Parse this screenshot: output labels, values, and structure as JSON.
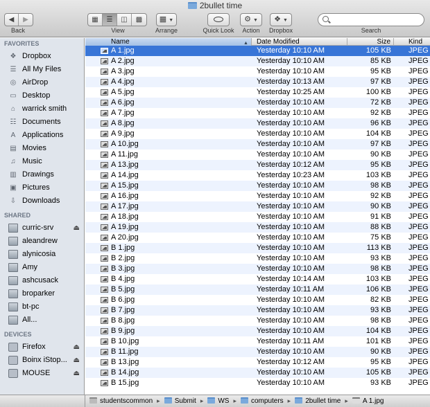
{
  "window": {
    "title": "2bullet time"
  },
  "toolbar": {
    "back_label": "Back",
    "view_label": "View",
    "arrange_label": "Arrange",
    "quicklook_label": "Quick Look",
    "action_label": "Action",
    "dropbox_label": "Dropbox",
    "search_label": "Search",
    "search_value": ""
  },
  "sidebar": {
    "favorites_heading": "FAVORITES",
    "favorites": [
      {
        "label": "Dropbox",
        "icon": "dropbox-icon"
      },
      {
        "label": "All My Files",
        "icon": "all-files-icon"
      },
      {
        "label": "AirDrop",
        "icon": "airdrop-icon"
      },
      {
        "label": "Desktop",
        "icon": "desktop-icon"
      },
      {
        "label": "warrick smith",
        "icon": "home-icon"
      },
      {
        "label": "Documents",
        "icon": "documents-icon"
      },
      {
        "label": "Applications",
        "icon": "applications-icon"
      },
      {
        "label": "Movies",
        "icon": "movies-icon"
      },
      {
        "label": "Music",
        "icon": "music-icon"
      },
      {
        "label": "Drawings",
        "icon": "folder-icon"
      },
      {
        "label": "Pictures",
        "icon": "pictures-icon"
      },
      {
        "label": "Downloads",
        "icon": "downloads-icon"
      }
    ],
    "shared_heading": "SHARED",
    "shared": [
      {
        "label": "curric-srv",
        "eject": true
      },
      {
        "label": "aleandrew",
        "eject": false
      },
      {
        "label": "alynicosia",
        "eject": false
      },
      {
        "label": "Amy",
        "eject": false
      },
      {
        "label": "ashcusack",
        "eject": false
      },
      {
        "label": "broparker",
        "eject": false
      },
      {
        "label": "bt-pc",
        "eject": false
      },
      {
        "label": "All...",
        "eject": false
      }
    ],
    "devices_heading": "DEVICES",
    "devices": [
      {
        "label": "Firefox",
        "eject": true
      },
      {
        "label": "Boinx iStop...",
        "eject": true
      },
      {
        "label": "MOUSE",
        "eject": true
      }
    ]
  },
  "columns": {
    "name": "Name",
    "date": "Date Modified",
    "size": "Size",
    "kind": "Kind"
  },
  "files": [
    {
      "name": "A 1.jpg",
      "date": "Yesterday 10:10 AM",
      "size": "105 KB",
      "kind": "JPEG",
      "selected": true
    },
    {
      "name": "A 2.jpg",
      "date": "Yesterday 10:10 AM",
      "size": "85 KB",
      "kind": "JPEG"
    },
    {
      "name": "A 3.jpg",
      "date": "Yesterday 10:10 AM",
      "size": "95 KB",
      "kind": "JPEG"
    },
    {
      "name": "A 4.jpg",
      "date": "Yesterday 10:13 AM",
      "size": "97 KB",
      "kind": "JPEG"
    },
    {
      "name": "A 5.jpg",
      "date": "Yesterday 10:25 AM",
      "size": "100 KB",
      "kind": "JPEG"
    },
    {
      "name": "A 6.jpg",
      "date": "Yesterday 10:10 AM",
      "size": "72 KB",
      "kind": "JPEG"
    },
    {
      "name": "A 7.jpg",
      "date": "Yesterday 10:10 AM",
      "size": "92 KB",
      "kind": "JPEG"
    },
    {
      "name": "A 8.jpg",
      "date": "Yesterday 10:10 AM",
      "size": "96 KB",
      "kind": "JPEG"
    },
    {
      "name": "A 9.jpg",
      "date": "Yesterday 10:10 AM",
      "size": "104 KB",
      "kind": "JPEG"
    },
    {
      "name": "A 10.jpg",
      "date": "Yesterday 10:10 AM",
      "size": "97 KB",
      "kind": "JPEG"
    },
    {
      "name": "A 11.jpg",
      "date": "Yesterday 10:10 AM",
      "size": "90 KB",
      "kind": "JPEG"
    },
    {
      "name": "A 13.jpg",
      "date": "Yesterday 10:12 AM",
      "size": "95 KB",
      "kind": "JPEG"
    },
    {
      "name": "A 14.jpg",
      "date": "Yesterday 10:23 AM",
      "size": "103 KB",
      "kind": "JPEG"
    },
    {
      "name": "A 15.jpg",
      "date": "Yesterday 10:10 AM",
      "size": "98 KB",
      "kind": "JPEG"
    },
    {
      "name": "A 16.jpg",
      "date": "Yesterday 10:10 AM",
      "size": "92 KB",
      "kind": "JPEG"
    },
    {
      "name": "A 17.jpg",
      "date": "Yesterday 10:10 AM",
      "size": "90 KB",
      "kind": "JPEG"
    },
    {
      "name": "A 18.jpg",
      "date": "Yesterday 10:10 AM",
      "size": "91 KB",
      "kind": "JPEG"
    },
    {
      "name": "A 19.jpg",
      "date": "Yesterday 10:10 AM",
      "size": "88 KB",
      "kind": "JPEG"
    },
    {
      "name": "A 20.jpg",
      "date": "Yesterday 10:10 AM",
      "size": "75 KB",
      "kind": "JPEG"
    },
    {
      "name": "B 1.jpg",
      "date": "Yesterday 10:10 AM",
      "size": "113 KB",
      "kind": "JPEG"
    },
    {
      "name": "B 2.jpg",
      "date": "Yesterday 10:10 AM",
      "size": "93 KB",
      "kind": "JPEG"
    },
    {
      "name": "B 3.jpg",
      "date": "Yesterday 10:10 AM",
      "size": "98 KB",
      "kind": "JPEG"
    },
    {
      "name": "B 4.jpg",
      "date": "Yesterday 10:14 AM",
      "size": "103 KB",
      "kind": "JPEG"
    },
    {
      "name": "B 5.jpg",
      "date": "Yesterday 10:11 AM",
      "size": "106 KB",
      "kind": "JPEG"
    },
    {
      "name": "B 6.jpg",
      "date": "Yesterday 10:10 AM",
      "size": "82 KB",
      "kind": "JPEG"
    },
    {
      "name": "B 7.jpg",
      "date": "Yesterday 10:10 AM",
      "size": "93 KB",
      "kind": "JPEG"
    },
    {
      "name": "B 8.jpg",
      "date": "Yesterday 10:10 AM",
      "size": "98 KB",
      "kind": "JPEG"
    },
    {
      "name": "B 9.jpg",
      "date": "Yesterday 10:10 AM",
      "size": "104 KB",
      "kind": "JPEG"
    },
    {
      "name": "B 10.jpg",
      "date": "Yesterday 10:11 AM",
      "size": "101 KB",
      "kind": "JPEG"
    },
    {
      "name": "B 11.jpg",
      "date": "Yesterday 10:10 AM",
      "size": "90 KB",
      "kind": "JPEG"
    },
    {
      "name": "B 13.jpg",
      "date": "Yesterday 10:12 AM",
      "size": "95 KB",
      "kind": "JPEG"
    },
    {
      "name": "B 14.jpg",
      "date": "Yesterday 10:10 AM",
      "size": "105 KB",
      "kind": "JPEG"
    },
    {
      "name": "B 15.jpg",
      "date": "Yesterday 10:10 AM",
      "size": "93 KB",
      "kind": "JPEG"
    }
  ],
  "pathbar": [
    {
      "label": "studentscommon",
      "icon": "disk-icon"
    },
    {
      "label": "Submit",
      "icon": "folder-icon"
    },
    {
      "label": "WS",
      "icon": "folder-icon"
    },
    {
      "label": "computers",
      "icon": "folder-icon"
    },
    {
      "label": "2bullet time",
      "icon": "folder-icon"
    },
    {
      "label": "A 1.jpg",
      "icon": "image-file-icon"
    }
  ],
  "colors": {
    "selection": "#3875d7",
    "sidebar_bg": "#e0e5ec",
    "stripe": "#edf3fe"
  }
}
